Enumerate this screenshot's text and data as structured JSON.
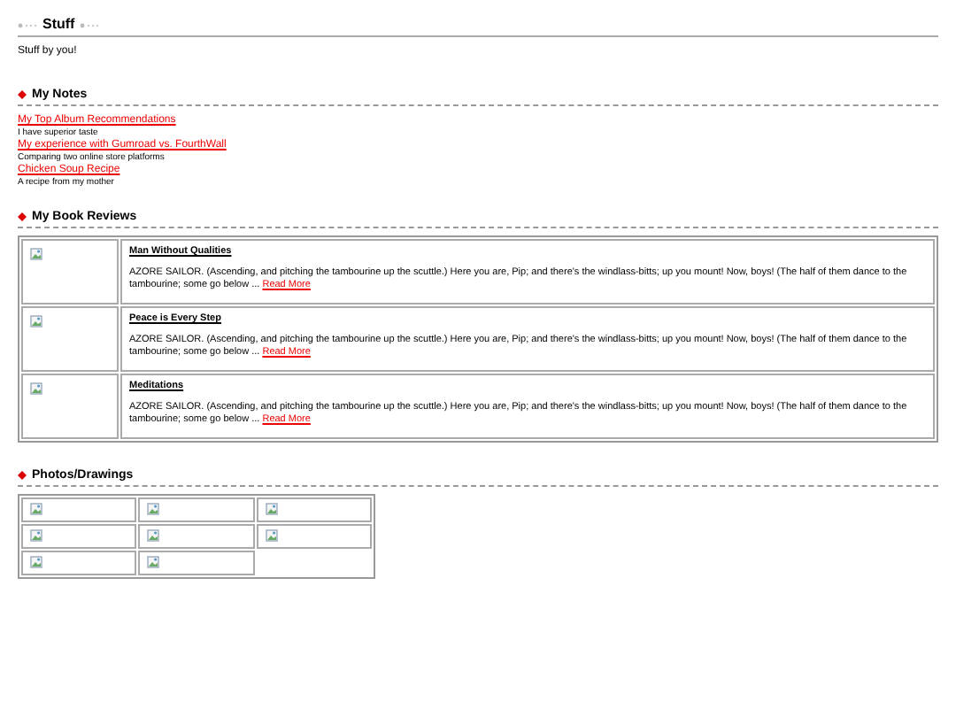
{
  "header": {
    "title": "Stuff",
    "subtitle": "Stuff by you!"
  },
  "notes": {
    "heading": "My Notes",
    "items": [
      {
        "title": "My Top Album Recommendations",
        "description": "I have superior taste"
      },
      {
        "title": "My experience with Gumroad vs. FourthWall",
        "description": "Comparing two online store platforms"
      },
      {
        "title": "Chicken Soup Recipe",
        "description": "A recipe from my mother"
      }
    ]
  },
  "reviews": {
    "heading": "My Book Reviews",
    "items": [
      {
        "title": "Man Without Qualities",
        "excerpt": "AZORE SAILOR. (Ascending, and pitching the tambourine up the scuttle.) Here you are, Pip; and there's the windlass-bitts; up you mount! Now, boys! (The half of them dance to the tambourine; some go below ...",
        "link": "Read More"
      },
      {
        "title": "Peace is Every Step",
        "excerpt": "AZORE SAILOR. (Ascending, and pitching the tambourine up the scuttle.) Here you are, Pip; and there's the windlass-bitts; up you mount! Now, boys! (The half of them dance to the tambourine; some go below ...",
        "link": "Read More"
      },
      {
        "title": "Meditations",
        "excerpt": "AZORE SAILOR. (Ascending, and pitching the tambourine up the scuttle.) Here you are, Pip; and there's the windlass-bitts; up you mount! Now, boys! (The half of them dance to the tambourine; some go below ...",
        "link": "Read More"
      }
    ]
  },
  "photos": {
    "heading": "Photos/Drawings"
  }
}
